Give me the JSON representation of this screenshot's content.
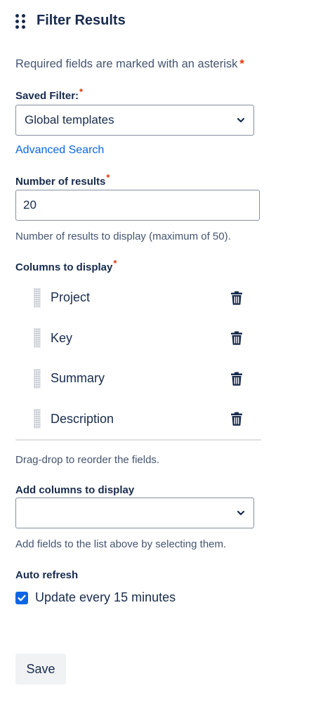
{
  "header": {
    "title": "Filter Results"
  },
  "required_note": {
    "text": "Required fields are marked with an asterisk",
    "asterisk": "*"
  },
  "saved_filter": {
    "label": "Saved Filter:",
    "asterisk": "*",
    "value": "Global templates",
    "advanced_search_label": "Advanced Search"
  },
  "number_of_results": {
    "label": "Number of results",
    "asterisk": "*",
    "value": "20",
    "help": "Number of results to display (maximum of 50)."
  },
  "columns": {
    "label": "Columns to display",
    "asterisk": "*",
    "items": [
      {
        "label": "Project"
      },
      {
        "label": "Key"
      },
      {
        "label": "Summary"
      },
      {
        "label": "Description"
      }
    ],
    "help": "Drag-drop to reorder the fields."
  },
  "add_columns": {
    "label": "Add columns to display",
    "value": "",
    "help": "Add fields to the list above by selecting them."
  },
  "auto_refresh": {
    "label": "Auto refresh",
    "checkbox_label": "Update every 15 minutes",
    "checked": true
  },
  "actions": {
    "save_label": "Save"
  },
  "colors": {
    "accent": "#0c66e4",
    "required": "#de350b",
    "text": "#172b4d",
    "muted": "#44546f"
  }
}
